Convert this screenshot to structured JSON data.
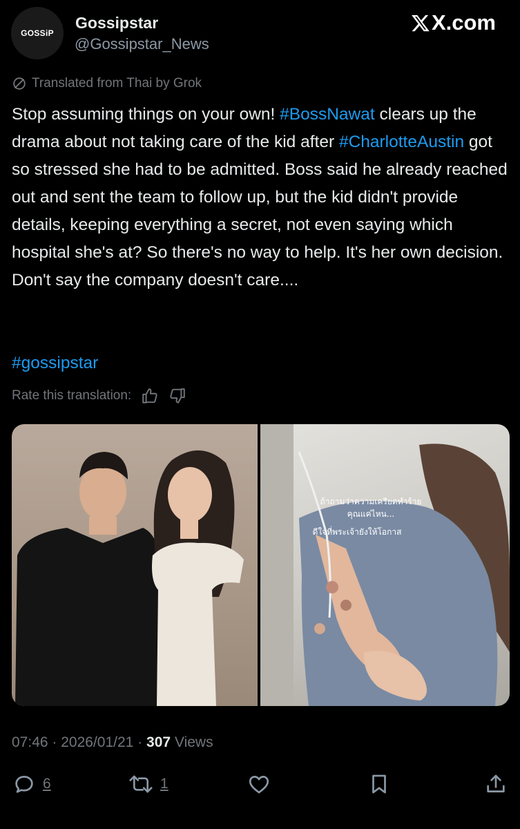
{
  "author": {
    "avatar_text": "GOSSiP",
    "display_name": "Gossipstar",
    "handle": "@Gossipstar_News"
  },
  "site": {
    "brand": "X.com"
  },
  "translation": {
    "label": "Translated from Thai by Grok",
    "rate_label": "Rate this translation:"
  },
  "tweet": {
    "text_1": "Stop assuming things on your own! ",
    "hashtag_1": "#BossNawat",
    "text_2": " clears up the drama about not taking care of the kid after ",
    "hashtag_2": "#CharlotteAustin",
    "text_3": " got so stressed she had to be admitted. Boss said he already reached out and sent the team to follow up, but the kid didn't provide details, keeping everything a secret, not even saying which hospital she's at? So there's no way to help. It's her own decision. Don't say the company doesn't care....",
    "hashtag_3": "#gossipstar"
  },
  "media": {
    "overlay_line_1": "ถ้าถามว่าความเครียดทำร้าย",
    "overlay_line_2": "คุณแค่ไหน...",
    "overlay_line_3": "ดีใจที่พระเจ้ายังให้โอกาส"
  },
  "meta": {
    "time": "07:46",
    "date": "2026/01/21",
    "separator": "·",
    "views_count": "307",
    "views_label": "Views"
  },
  "actions": {
    "reply_count": "6",
    "repost_count": "1"
  },
  "colors": {
    "background": "#000000",
    "text": "#e7e9ea",
    "secondary": "#71767b",
    "accent": "#1d9bf0"
  },
  "icons": [
    "translate-icon",
    "thumbs-up-icon",
    "thumbs-down-icon",
    "reply-icon",
    "repost-icon",
    "like-icon",
    "bookmark-icon",
    "share-icon",
    "x-logo-icon"
  ]
}
